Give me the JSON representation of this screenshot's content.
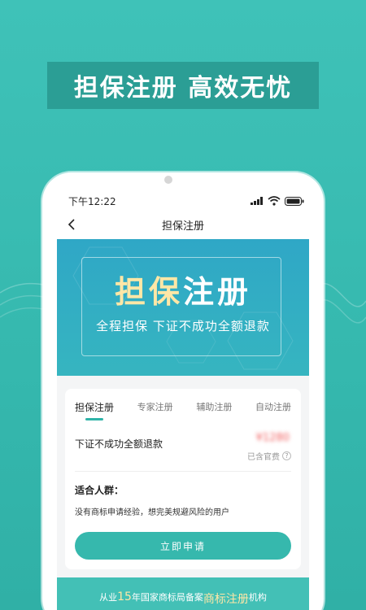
{
  "headline": "担保注册 高效无忧",
  "status_bar": {
    "time": "下午12:22"
  },
  "nav": {
    "title": "担保注册"
  },
  "banner": {
    "title_part1": "担保",
    "title_part2": "注册",
    "subtitle": "全程担保 下证不成功全额退款"
  },
  "tabs": [
    {
      "label": "担保注册",
      "active": true
    },
    {
      "label": "专家注册",
      "active": false
    },
    {
      "label": "辅助注册",
      "active": false
    },
    {
      "label": "自动注册",
      "active": false
    }
  ],
  "service": {
    "description": "下证不成功全额退款",
    "price": "¥1280",
    "fee_note": "已含官费"
  },
  "audience": {
    "label": "适合人群：",
    "text": "没有商标申请经验，想完美规避风险的用户"
  },
  "apply_button": "立即申请",
  "bottom_banner": {
    "part1": "从业",
    "years": "15",
    "part2": "年国家商标局备案",
    "highlight": "商标注册",
    "part3": "机构"
  },
  "colors": {
    "background": "#3fc2b8",
    "accent": "#36b8ad",
    "price": "#f05a5a",
    "highlight": "#ffe7a6"
  }
}
